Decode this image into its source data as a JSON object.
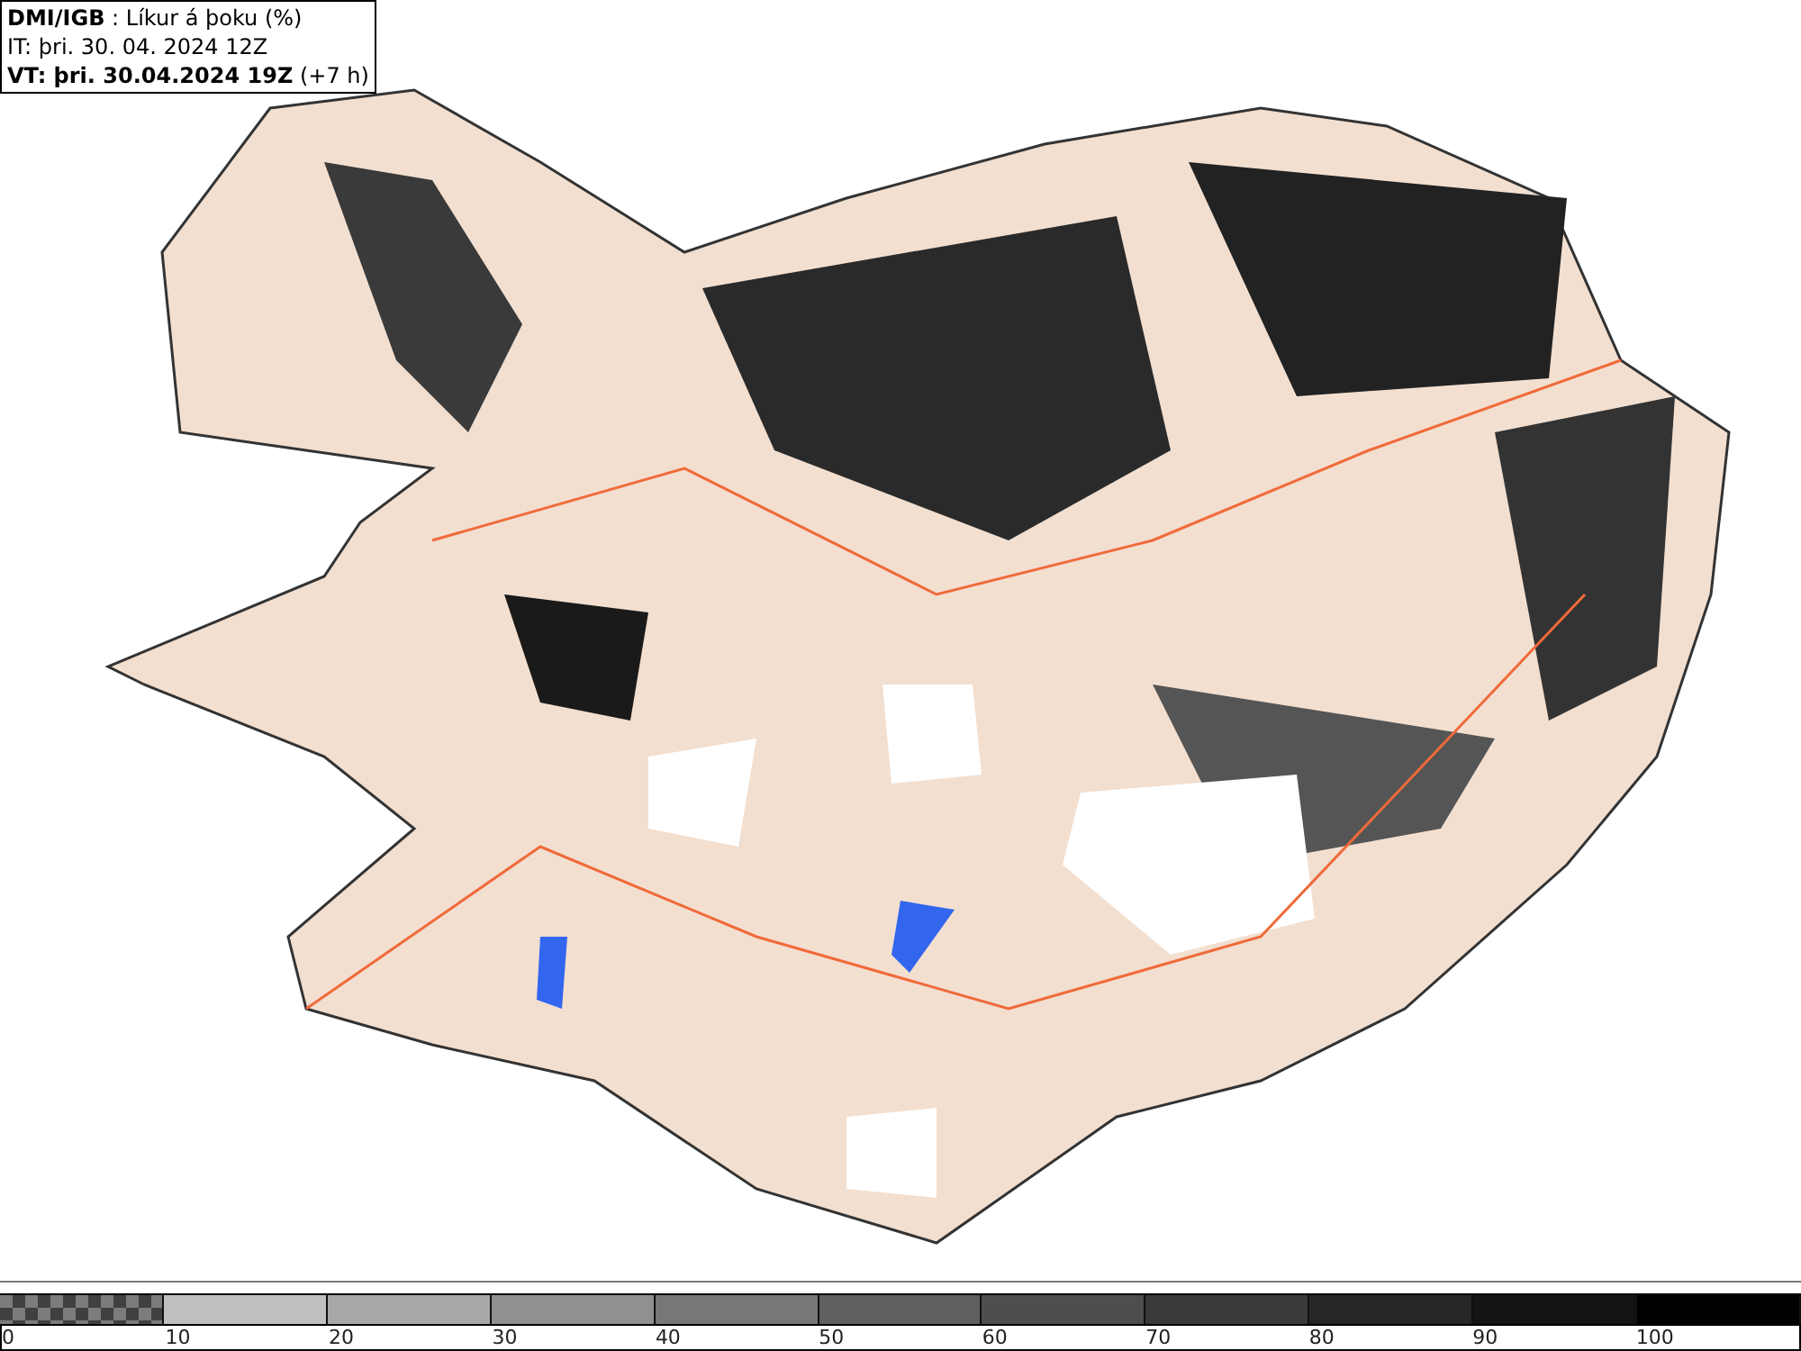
{
  "title_box": {
    "lines": [
      "**DMI/IGB** : Líkur á þoku (%)",
      "IT: þri. 30. 04. 2024 12Z",
      "**VT: þri. 30.04.2024 19Z** (+7 h)"
    ]
  },
  "legend": [
    {
      "label": "0",
      "color": "#7c7c7c",
      "kind": "checker"
    },
    {
      "label": "10",
      "color": "#c0c0c0",
      "kind": "solid"
    },
    {
      "label": "20",
      "color": "#a8a8a8",
      "kind": "solid"
    },
    {
      "label": "30",
      "color": "#909090",
      "kind": "solid"
    },
    {
      "label": "40",
      "color": "#777777",
      "kind": "solid"
    },
    {
      "label": "50",
      "color": "#606060",
      "kind": "solid"
    },
    {
      "label": "60",
      "color": "#4e4e4e",
      "kind": "solid"
    },
    {
      "label": "70",
      "color": "#3a3a3a",
      "kind": "solid"
    },
    {
      "label": "80",
      "color": "#262626",
      "kind": "solid"
    },
    {
      "label": "90",
      "color": "#141414",
      "kind": "solid"
    },
    {
      "label": "100",
      "color": "#000000",
      "kind": "solid"
    }
  ]
}
